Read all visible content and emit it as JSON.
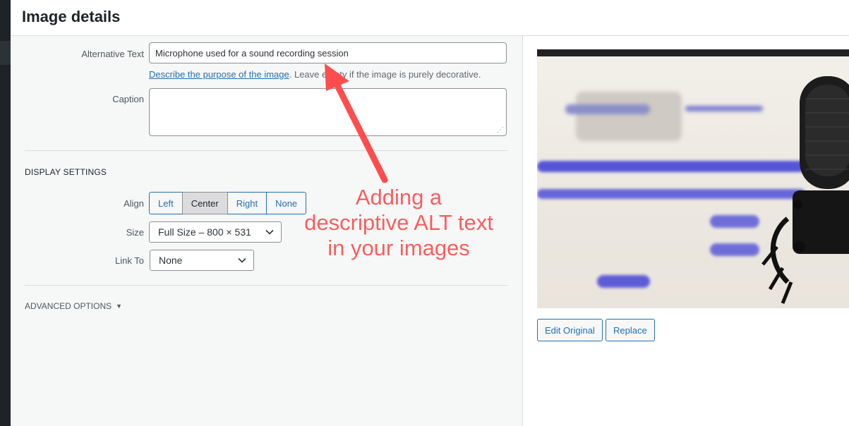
{
  "modal": {
    "title": "Image details"
  },
  "alt_text": {
    "label": "Alternative Text",
    "value": "Microphone used for a sound recording session",
    "help_link": "Describe the purpose of the image",
    "help_suffix": ". Leave empty if the image is purely decorative."
  },
  "caption": {
    "label": "Caption",
    "value": ""
  },
  "display_settings": {
    "heading": "DISPLAY SETTINGS",
    "align": {
      "label": "Align",
      "options": [
        "Left",
        "Center",
        "Right",
        "None"
      ],
      "selected": "Center"
    },
    "size": {
      "label": "Size",
      "value": "Full Size – 800 × 531"
    },
    "link_to": {
      "label": "Link To",
      "value": "None"
    }
  },
  "advanced": {
    "label": "ADVANCED OPTIONS"
  },
  "image_actions": {
    "edit_original": "Edit Original",
    "replace": "Replace"
  },
  "annotation": {
    "lines": [
      "Adding a",
      "descriptive ALT text",
      "in your images"
    ],
    "color": "#ff5a5a"
  },
  "colors": {
    "accent": "#2271b1",
    "pane_bg": "#f6f7f7"
  },
  "icons": {
    "chevron": "chevron-down-icon",
    "resize": "resize-grip-icon",
    "triangle": "triangle-down-icon"
  }
}
